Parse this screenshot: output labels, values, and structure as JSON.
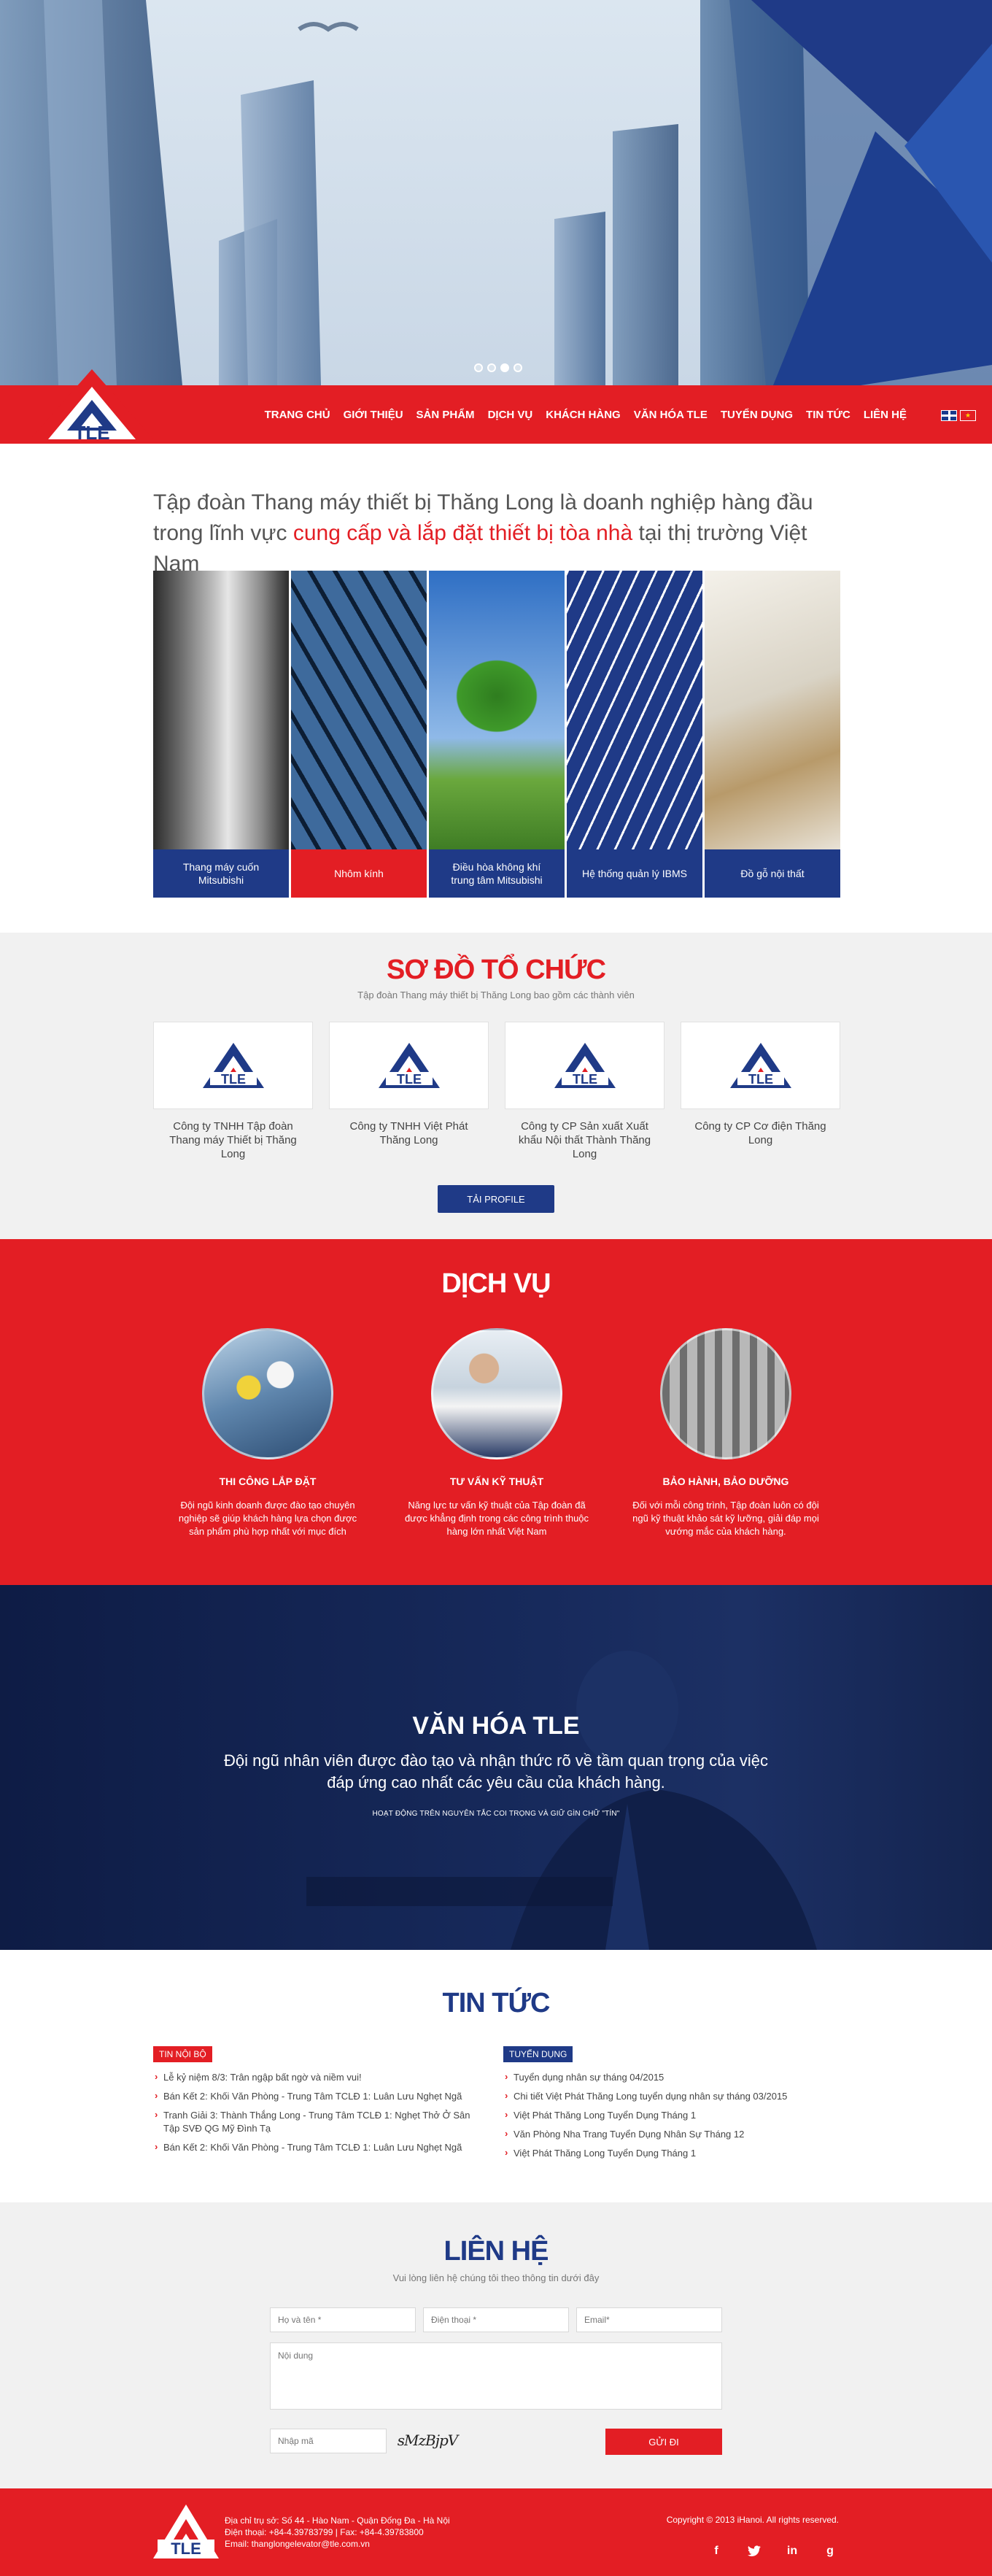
{
  "hero": {
    "slide_count": 4,
    "active_slide": 3
  },
  "nav": {
    "items": [
      "TRANG CHỦ",
      "GIỚI THIỆU",
      "SẢN PHẨM",
      "DỊCH VỤ",
      "KHÁCH HÀNG",
      "VĂN HÓA TLE",
      "TUYỂN DỤNG",
      "TIN TỨC",
      "LIÊN HỆ"
    ],
    "logo_text": "TLE"
  },
  "intro": {
    "text_before": "Tập đoàn Thang máy thiết bị Thăng Long là doanh nghiệp hàng đầu trong lĩnh vực ",
    "highlight": "cung cấp và lắp đặt thiết bị tòa nhà",
    "text_after": " tại thị trường Việt Nam"
  },
  "products": [
    {
      "label": "Thang máy cuốn Mitsubishi"
    },
    {
      "label": "Nhôm kính"
    },
    {
      "label": "Điều hòa không khí trung tâm Mitsubishi"
    },
    {
      "label": "Hệ thống quản lý IBMS"
    },
    {
      "label": "Đồ gỗ nội thất"
    }
  ],
  "org": {
    "title": "SƠ ĐỒ TỔ CHỨC",
    "subtitle": "Tập đoàn Thang máy thiết bị Thăng Long bao gồm các thành viên",
    "companies": [
      "Công ty TNHH Tập đoàn Thang máy Thiết bị Thăng Long",
      "Công ty TNHH Việt Phát Thăng Long",
      "Công ty CP Sản xuất Xuất khẩu Nội thất Thành Thăng Long",
      "Công ty CP Cơ điện Thăng Long"
    ],
    "button": "TẢI PROFILE"
  },
  "services": {
    "title": "DỊCH VỤ",
    "items": [
      {
        "title": "THI CÔNG LẮP ĐẶT",
        "desc": "Đội ngũ kinh doanh được đào tạo chuyên nghiệp sẽ giúp khách hàng lựa chọn được sản phẩm phù hợp nhất với mục đích"
      },
      {
        "title": "TƯ VẤN KỸ THUẬT",
        "desc": "Năng lực tư vấn kỹ thuật của Tập đoàn đã được khẳng định trong các công trình thuộc hàng lớn nhất Việt Nam"
      },
      {
        "title": "BẢO HÀNH, BẢO DƯỠNG",
        "desc": "Đối với mỗi công trình, Tập đoàn luôn có đội ngũ kỹ thuật khảo sát kỹ lưỡng, giải đáp mọi vướng mắc của khách hàng."
      }
    ]
  },
  "culture": {
    "title": "VĂN HÓA TLE",
    "text": "Đội ngũ nhân viên được đào tạo và nhận thức rõ về tầm quan trọng của việc đáp ứng cao nhất các yêu cầu của khách hàng.",
    "small": "HOẠT ĐỘNG TRÊN NGUYÊN TẮC COI TRỌNG VÀ GIỮ GÌN CHỮ \"TÍN\""
  },
  "news": {
    "title": "TIN TỨC",
    "internal": {
      "tag": "TIN NỘI BỘ",
      "items": [
        "Lễ kỷ niệm 8/3: Trân ngập bất ngờ và niềm vui!",
        "Bán Kết 2: Khối Văn Phòng - Trung Tâm TCLĐ 1: Luân Lưu Nghẹt Ngã",
        "Tranh Giải 3: Thành Thắng Long - Trung Tâm TCLĐ 1: Nghẹt Thở Ở Sân Tập SVĐ QG Mỹ Đình Tạ",
        "Bán Kết 2: Khối Văn Phòng - Trung Tâm TCLĐ 1: Luân Lưu Nghẹt Ngã"
      ]
    },
    "recruit": {
      "tag": "TUYỂN DỤNG",
      "items": [
        "Tuyển dụng nhân sự tháng 04/2015",
        "Chi tiết Việt Phát Thăng Long tuyển dụng nhân sự tháng 03/2015",
        "Việt Phát Thăng Long Tuyển Dụng Tháng 1",
        "Văn Phòng Nha Trang Tuyển Dụng Nhân Sự Tháng 12",
        "Việt Phát Thăng Long Tuyển Dụng Tháng 1"
      ]
    }
  },
  "contact": {
    "title": "LIÊN HỆ",
    "subtitle": "Vui lòng liên hệ chúng tôi theo thông tin dưới đây",
    "name_placeholder": "Họ và tên *",
    "phone_placeholder": "Điện thoại *",
    "email_placeholder": "Email*",
    "content_placeholder": "Nội dung",
    "captcha_placeholder": "Nhập mã",
    "captcha_text": "sMzBjpV",
    "button": "GỬI ĐI"
  },
  "footer": {
    "address": "Địa chỉ trụ sở: Số 44 - Hào Nam - Quận Đống Đa - Hà Nội",
    "phone": "Điện thoại: +84-4.39783799  |  Fax: +84-4.39783800",
    "email": "Email: thanglongelevator@tle.com.vn",
    "copyright": "Copyright © 2013 iHanoi. All rights reserved.",
    "socials": [
      "facebook-icon",
      "twitter-icon",
      "linkedin-icon",
      "googleplus-icon"
    ]
  },
  "colors": {
    "brand_red": "#e31e24",
    "brand_blue": "#1f3a87",
    "dark_navy": "#14244f"
  }
}
